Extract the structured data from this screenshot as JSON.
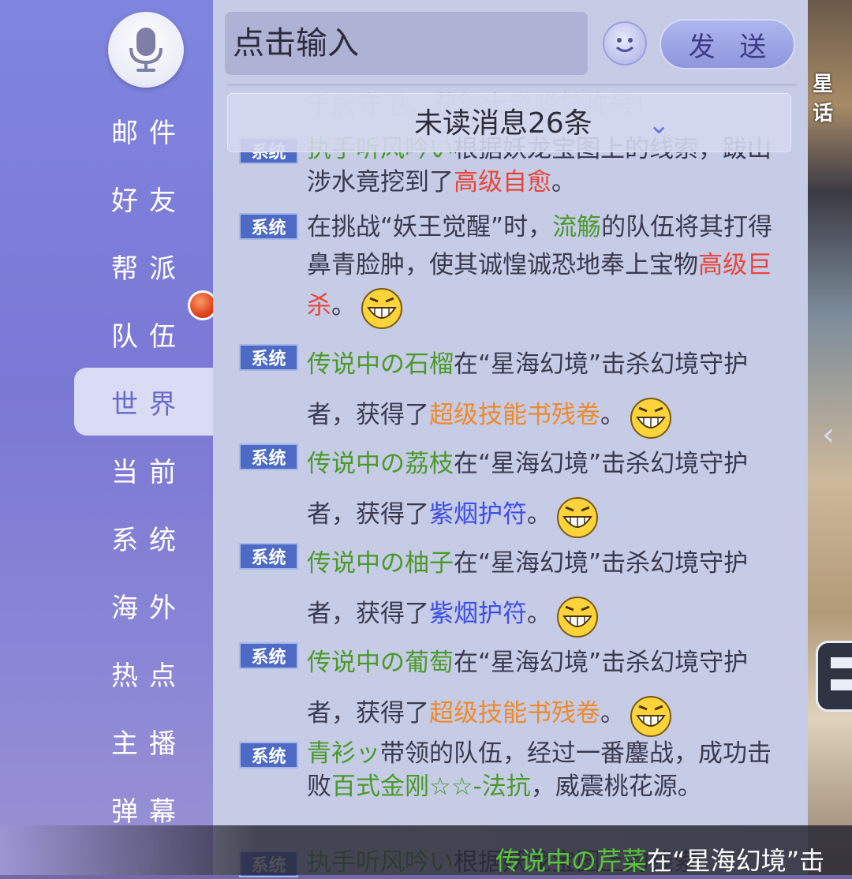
{
  "input": {
    "placeholder": "点击输入"
  },
  "send_label": "发 送",
  "unread_label": "未读消息26条",
  "ghost_text": "千层守卫，获得大资聪慧称号！",
  "sidebar": {
    "items": [
      {
        "label": "邮件"
      },
      {
        "label": "好友"
      },
      {
        "label": "帮派"
      },
      {
        "label": "队伍"
      },
      {
        "label": "世界",
        "active": true
      },
      {
        "label": "当前"
      },
      {
        "label": "系统"
      },
      {
        "label": "海外"
      },
      {
        "label": "热点"
      },
      {
        "label": "主播"
      },
      {
        "label": "弹幕"
      }
    ]
  },
  "badge_label": "系统",
  "messages": [
    {
      "parts": [
        {
          "t": "执手听风吟い",
          "c": "g"
        },
        {
          "t": "根据妖龙宝图上的线索，跋山涉水竟挖到了"
        },
        {
          "t": "高级自愈",
          "c": "r"
        },
        {
          "t": "。"
        }
      ]
    },
    {
      "parts": [
        {
          "t": "在挑战“妖王觉醒”时，"
        },
        {
          "t": "流觞",
          "c": "g"
        },
        {
          "t": "的队伍将其打得鼻青脸肿，使其诚惶诚恐地奉上宝物"
        },
        {
          "t": "高级巨杀",
          "c": "r"
        },
        {
          "t": "。"
        }
      ],
      "emoji": true
    },
    {
      "parts": [
        {
          "t": "传说中の石榴",
          "c": "g"
        },
        {
          "t": "在“星海幻境”击杀幻境守护者，获得了"
        },
        {
          "t": "超级技能书残卷",
          "c": "o"
        },
        {
          "t": "。"
        }
      ],
      "emoji": true
    },
    {
      "parts": [
        {
          "t": "传说中の荔枝",
          "c": "g"
        },
        {
          "t": "在“星海幻境”击杀幻境守护者，获得了"
        },
        {
          "t": "紫烟护符",
          "c": "b"
        },
        {
          "t": "。"
        }
      ],
      "emoji": true
    },
    {
      "parts": [
        {
          "t": "传说中の柚子",
          "c": "g"
        },
        {
          "t": "在“星海幻境”击杀幻境守护者，获得了"
        },
        {
          "t": "紫烟护符",
          "c": "b"
        },
        {
          "t": "。"
        }
      ],
      "emoji": true
    },
    {
      "parts": [
        {
          "t": "传说中の葡萄",
          "c": "g"
        },
        {
          "t": "在“星海幻境”击杀幻境守护者，获得了"
        },
        {
          "t": "超级技能书残卷",
          "c": "o"
        },
        {
          "t": "。"
        }
      ],
      "emoji": true
    },
    {
      "parts": [
        {
          "t": "青衫ッ",
          "c": "g"
        },
        {
          "t": "带领的队伍，经过一番鏖战，成功击败"
        },
        {
          "t": "百式金刚☆☆-法抗",
          "c": "g"
        },
        {
          "t": "，威震桃花源。"
        }
      ]
    },
    {
      "parts": [
        {
          "t": "执手听风吟い",
          "c": "g"
        },
        {
          "t": "根据妖龙宝图上的线索"
        }
      ]
    }
  ],
  "bottom_ticker": [
    {
      "t": "传说中の芹菜",
      "c": "g"
    },
    {
      "t": "在“星海幻境”击"
    }
  ],
  "scene_label": "星话",
  "colors": {
    "accent": "#7b78d4",
    "badge": "#4d6bc5",
    "name_green": "#4a9a2a",
    "item_red": "#e8463a",
    "item_orange": "#ee8a2c",
    "item_blue": "#3d4fe8"
  }
}
